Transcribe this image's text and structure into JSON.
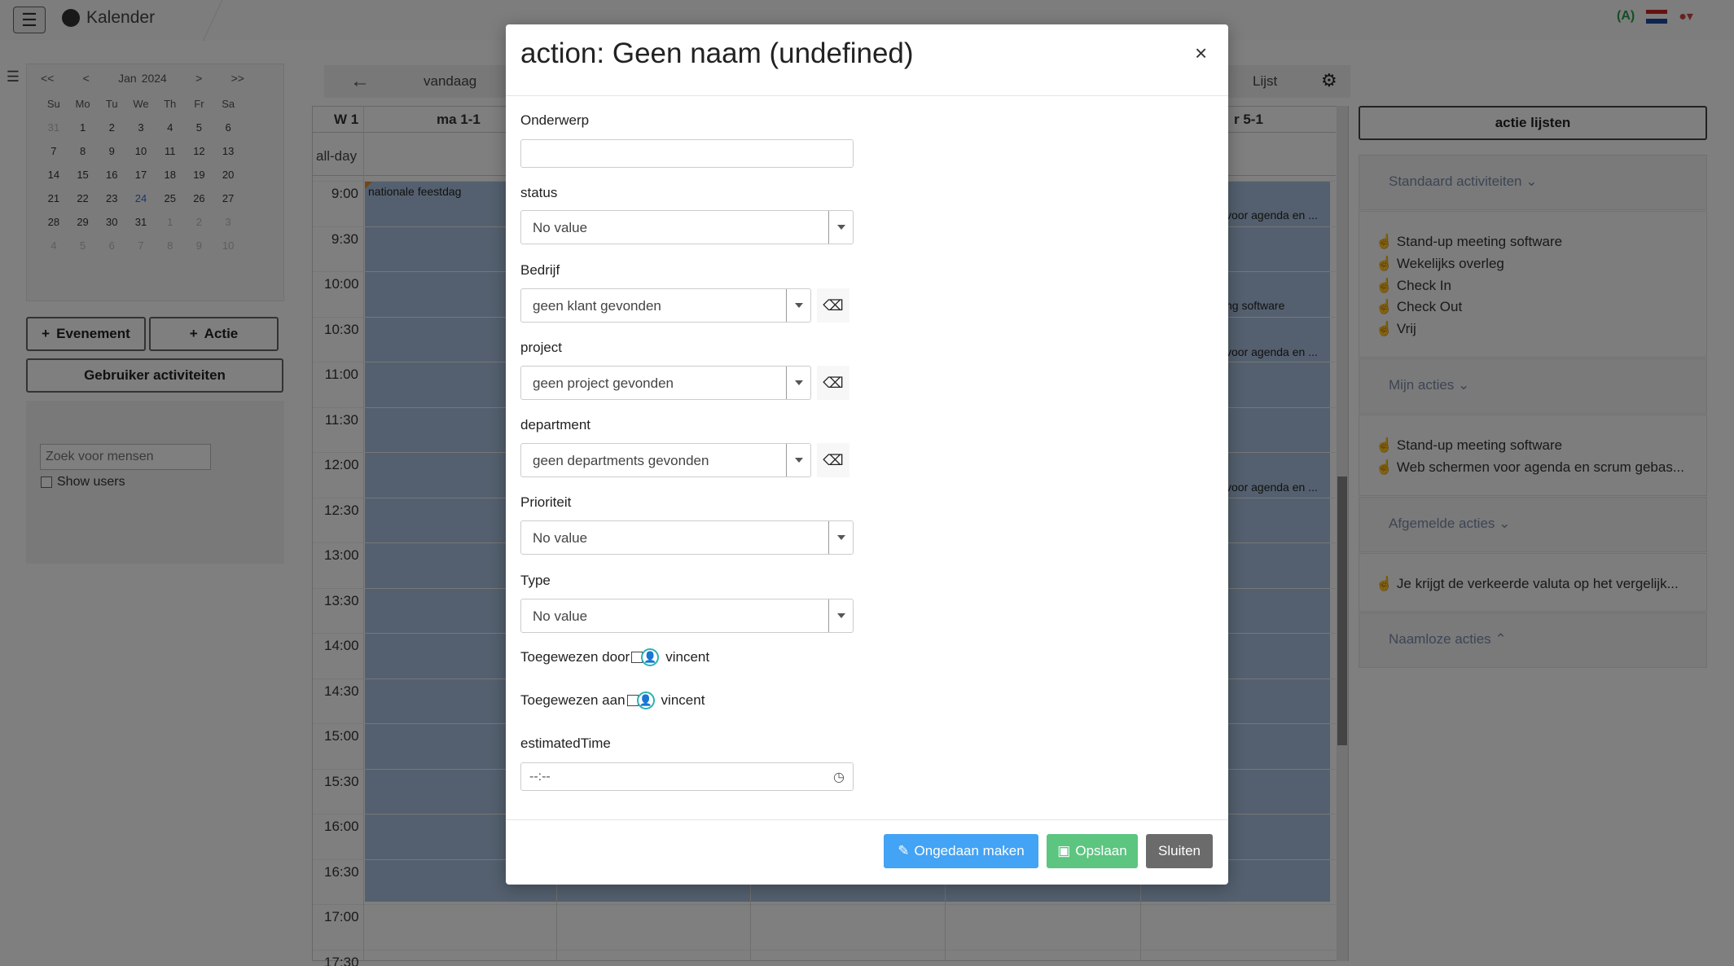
{
  "app": {
    "title": "Kalender"
  },
  "mini_calendar": {
    "month": "Jan",
    "year": "2024",
    "nav_prev_year": "<<",
    "nav_prev": "<",
    "nav_next": ">",
    "nav_next_year": ">>",
    "weekdays": [
      "Su",
      "Mo",
      "Tu",
      "We",
      "Th",
      "Fr",
      "Sa"
    ],
    "weeks": [
      [
        "31",
        "1",
        "2",
        "3",
        "4",
        "5",
        "6"
      ],
      [
        "7",
        "8",
        "9",
        "10",
        "11",
        "12",
        "13"
      ],
      [
        "14",
        "15",
        "16",
        "17",
        "18",
        "19",
        "20"
      ],
      [
        "21",
        "22",
        "23",
        "24",
        "25",
        "26",
        "27"
      ],
      [
        "28",
        "29",
        "30",
        "31",
        "1",
        "2",
        "3"
      ],
      [
        "4",
        "5",
        "6",
        "7",
        "8",
        "9",
        "10"
      ]
    ]
  },
  "sidebar": {
    "event_button": "Evenement",
    "action_button": "Actie",
    "user_activities_button": "Gebruiker activiteiten",
    "search_placeholder": "Zoek voor mensen",
    "show_users_label": "Show users"
  },
  "calendar": {
    "today_label": "vandaag",
    "list_label": "Lijst",
    "week_label": "W 1",
    "day1_label": "ma 1-1",
    "day5_label": "r 5-1",
    "allday_label": "all-day",
    "times": [
      "9:00",
      "9:30",
      "10:00",
      "10:30",
      "11:00",
      "11:30",
      "12:00",
      "12:30",
      "13:00",
      "13:30",
      "14:00",
      "14:30",
      "15:00",
      "15:30",
      "16:00",
      "16:30",
      "17:00",
      "17:30"
    ],
    "holiday_event": "nationale feestdag",
    "events_right": [
      "voor agenda en ...",
      "ng software",
      "voor agenda en ...",
      "voor agenda en ..."
    ]
  },
  "right_panel": {
    "title_button": "actie lijsten",
    "sections": [
      {
        "title": "Standaard activiteiten",
        "items": [
          "Stand-up meeting software",
          "Wekelijks overleg",
          "Check In",
          "Check Out",
          "Vrij"
        ]
      },
      {
        "title": "Mijn acties",
        "items": [
          "Stand-up meeting software",
          "Web schermen voor agenda en scrum gebas..."
        ]
      },
      {
        "title": "Afgemelde acties",
        "items": [
          "Je krijgt de verkeerde valuta op het vergelijk..."
        ]
      },
      {
        "title": "Naamloze acties",
        "items": []
      }
    ]
  },
  "modal": {
    "title": "action: Geen naam (undefined)",
    "close_symbol": "×",
    "fields": {
      "subject_label": "Onderwerp",
      "subject_value": "",
      "status_label": "status",
      "status_value": "No value",
      "company_label": "Bedrijf",
      "company_value": "geen klant gevonden",
      "project_label": "project",
      "project_value": "geen project gevonden",
      "department_label": "department",
      "department_value": "geen departments gevonden",
      "priority_label": "Prioriteit",
      "priority_value": "No value",
      "type_label": "Type",
      "type_value": "No value",
      "assigned_by_label": "Toegewezen door",
      "assigned_by_user": "vincent",
      "assigned_to_label": "Toegewezen aan",
      "assigned_to_user": "vincent",
      "estimated_label": "estimatedTime",
      "estimated_value": "--:--"
    },
    "buttons": {
      "undo": "Ongedaan maken",
      "save": "Opslaan",
      "close": "Sluiten"
    }
  },
  "colors": {
    "undo": "#43a3f4",
    "save": "#5cc580",
    "close": "#6b6b6b",
    "event_fill": "#a9c0df",
    "assign_icon": "#2bb3b0"
  }
}
